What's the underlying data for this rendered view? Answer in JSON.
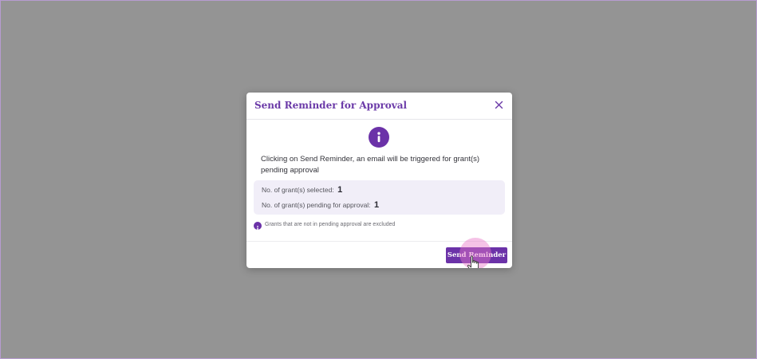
{
  "modal": {
    "title": "Send Reminder for Approval",
    "close_icon": "close-icon",
    "info_icon": "info-icon",
    "message": "Clicking on Send Reminder, an email will be triggered for grant(s) pending approval",
    "summary": {
      "selected_label": "No. of grant(s) selected:",
      "selected_count": "1",
      "pending_label": "No. of grant(s) pending for approval:",
      "pending_count": "1"
    },
    "note": "Grants that are not in pending approval are excluded",
    "send_button_label": "Send Reminder"
  },
  "colors": {
    "accent": "#6b32a8",
    "backdrop": "#949494",
    "summary_bg": "#f1eef8"
  }
}
